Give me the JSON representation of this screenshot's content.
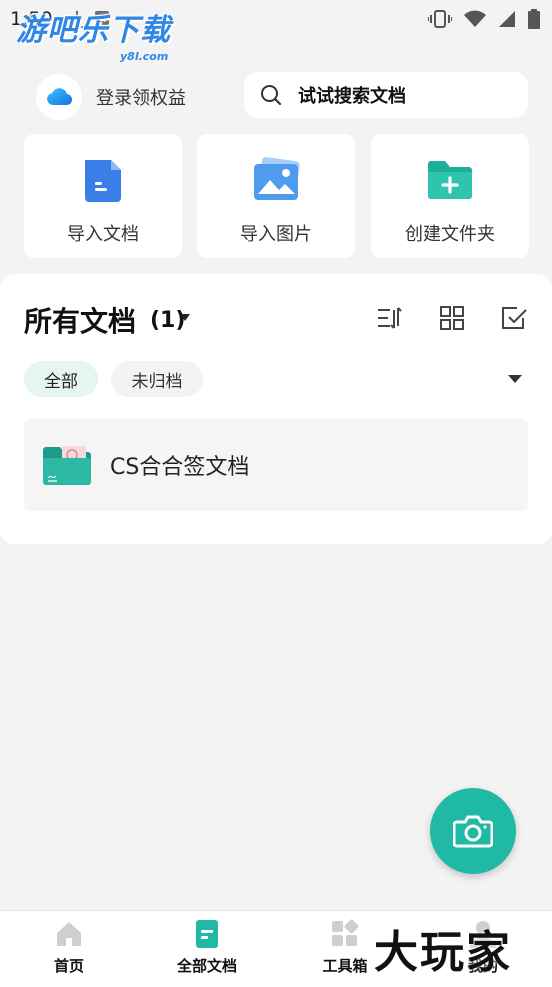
{
  "status_bar": {
    "time": "1:50",
    "watermark": "游吧乐下载",
    "watermark_sub": "y8l.com"
  },
  "header": {
    "login_label": "登录领权益",
    "search_placeholder": "试试搜索文档"
  },
  "quick_actions": [
    {
      "label": "导入文档",
      "icon": "document-icon"
    },
    {
      "label": "导入图片",
      "icon": "image-icon"
    },
    {
      "label": "创建文件夹",
      "icon": "folder-add-icon"
    }
  ],
  "documents": {
    "title": "所有文档",
    "count": "(1)",
    "filters": {
      "all": "全部",
      "unfiled": "未归档"
    },
    "items": [
      {
        "name": "CS合合签文档"
      }
    ]
  },
  "bottom_nav": [
    {
      "label": "首页",
      "icon": "home-icon"
    },
    {
      "label": "全部文档",
      "icon": "all-docs-icon",
      "active": true
    },
    {
      "label": "工具箱",
      "icon": "toolbox-icon"
    },
    {
      "label": "我的",
      "icon": "profile-icon"
    }
  ],
  "brand_mark": "大玩家",
  "colors": {
    "accent": "#20b9a5",
    "doc_blue": "#3a7fe8",
    "image_blue": "#4e9bf0",
    "folder_green": "#1fae9b"
  }
}
